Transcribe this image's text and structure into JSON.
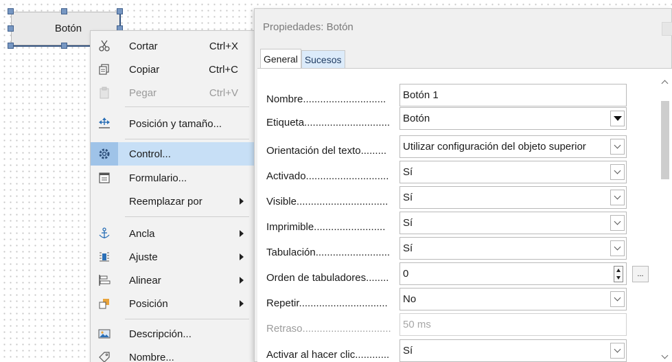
{
  "canvas": {
    "button_label": "Botón"
  },
  "context_menu": {
    "items": [
      {
        "label": "Cortar",
        "shortcut": "Ctrl+X",
        "icon": "scissors-icon"
      },
      {
        "label": "Copiar",
        "shortcut": "Ctrl+C",
        "icon": "copy-icon"
      },
      {
        "label": "Pegar",
        "shortcut": "Ctrl+V",
        "icon": "clipboard-icon"
      },
      {
        "label": "Posición y tamaño...",
        "icon": "position-size-icon"
      },
      {
        "label": "Control...",
        "icon": "gear-icon"
      },
      {
        "label": "Formulario...",
        "icon": "form-icon"
      },
      {
        "label": "Reemplazar por"
      },
      {
        "label": "Ancla",
        "icon": "anchor-icon"
      },
      {
        "label": "Ajuste",
        "icon": "wrap-icon"
      },
      {
        "label": "Alinear",
        "icon": "align-icon"
      },
      {
        "label": "Posición",
        "icon": "arrange-icon"
      },
      {
        "label": "Descripción...",
        "icon": "image-description-icon"
      },
      {
        "label": "Nombre...",
        "icon": "tag-icon"
      }
    ]
  },
  "dialog": {
    "title": "Propiedades: Botón",
    "tabs": [
      "General",
      "Sucesos"
    ],
    "properties": [
      {
        "label": "Nombre.............................",
        "value": "Botón 1"
      },
      {
        "label": "Etiqueta..............................",
        "value": "Botón"
      },
      {
        "label": "Orientación del texto.........",
        "value": "Utilizar configuración del objeto superior"
      },
      {
        "label": "Activado.............................",
        "value": "Sí"
      },
      {
        "label": "Visible................................",
        "value": "Sí"
      },
      {
        "label": "Imprimible.........................",
        "value": "Sí"
      },
      {
        "label": "Tabulación..........................",
        "value": "Sí"
      },
      {
        "label": "Orden de tabuladores........",
        "value": "0"
      },
      {
        "label": "Repetir...............................",
        "value": "No"
      },
      {
        "label": "Retraso...............................",
        "value": "50 ms"
      },
      {
        "label": "Activar al hacer clic............",
        "value": "Sí"
      }
    ],
    "ellipsis_label": "..."
  }
}
